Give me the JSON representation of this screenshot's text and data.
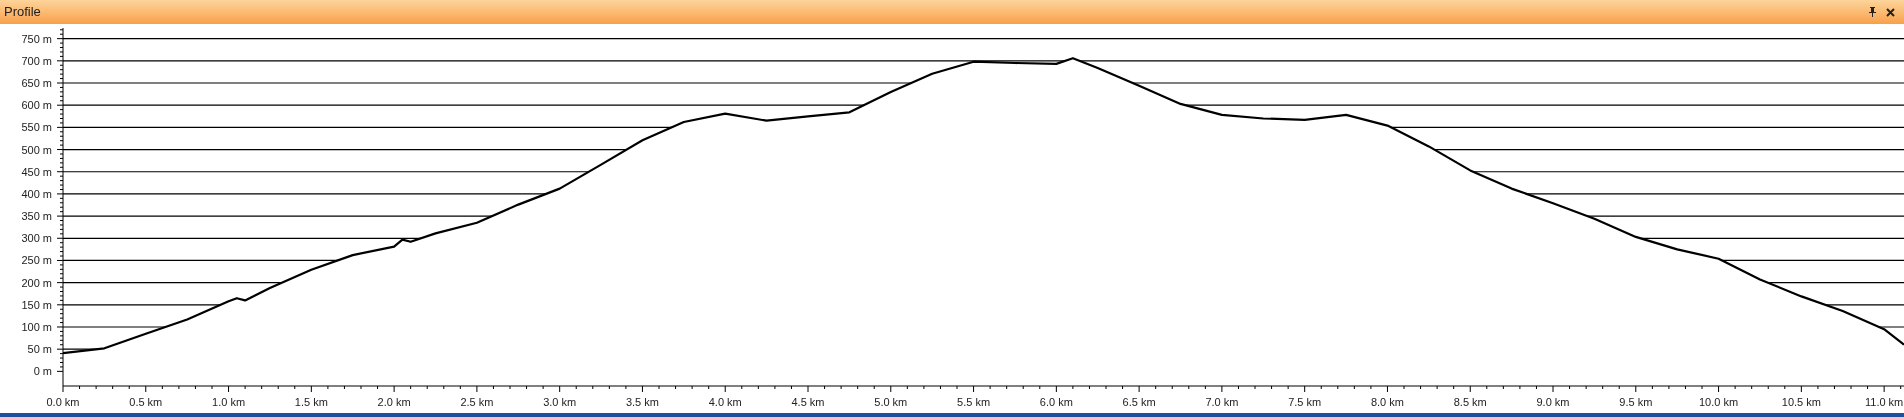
{
  "panel": {
    "title": "Profile"
  },
  "chart_data": {
    "type": "line",
    "grid": true,
    "xlim": [
      0,
      11.12
    ],
    "ylim": [
      -33,
      774
    ],
    "x": [
      0,
      0.25,
      0.5,
      0.75,
      1.0,
      1.05,
      1.1,
      1.25,
      1.5,
      1.75,
      2.0,
      2.05,
      2.1,
      2.25,
      2.5,
      2.75,
      3.0,
      3.25,
      3.5,
      3.75,
      4.0,
      4.25,
      4.5,
      4.75,
      5.0,
      5.25,
      5.5,
      5.75,
      6.0,
      6.1,
      6.25,
      6.5,
      6.75,
      7.0,
      7.25,
      7.5,
      7.75,
      8.0,
      8.25,
      8.5,
      8.75,
      9.0,
      9.25,
      9.5,
      9.75,
      10.0,
      10.25,
      10.5,
      10.75,
      11.0,
      11.12
    ],
    "values": [
      41,
      52,
      85,
      117,
      158,
      165,
      160,
      188,
      229,
      262,
      281,
      297,
      292,
      311,
      335,
      376,
      412,
      466,
      521,
      562,
      581,
      565,
      575,
      584,
      630,
      671,
      698,
      695,
      693,
      706,
      684,
      644,
      603,
      578,
      570,
      567,
      578,
      554,
      507,
      453,
      412,
      379,
      344,
      303,
      275,
      254,
      207,
      169,
      136,
      95,
      60
    ],
    "yticks": [
      {
        "value": 0,
        "label": "0 m"
      },
      {
        "value": 50,
        "label": "50 m"
      },
      {
        "value": 100,
        "label": "100 m"
      },
      {
        "value": 150,
        "label": "150 m"
      },
      {
        "value": 200,
        "label": "200 m"
      },
      {
        "value": 250,
        "label": "250 m"
      },
      {
        "value": 300,
        "label": "300 m"
      },
      {
        "value": 350,
        "label": "350 m"
      },
      {
        "value": 400,
        "label": "400 m"
      },
      {
        "value": 450,
        "label": "450 m"
      },
      {
        "value": 500,
        "label": "500 m"
      },
      {
        "value": 550,
        "label": "550 m"
      },
      {
        "value": 600,
        "label": "600 m"
      },
      {
        "value": 650,
        "label": "650 m"
      },
      {
        "value": 700,
        "label": "700 m"
      },
      {
        "value": 750,
        "label": "750 m"
      }
    ],
    "xticks": [
      {
        "value": 0,
        "label": "0.0 km"
      },
      {
        "value": 0.5,
        "label": "0.5 km"
      },
      {
        "value": 1,
        "label": "1.0 km"
      },
      {
        "value": 1.5,
        "label": "1.5 km"
      },
      {
        "value": 2,
        "label": "2.0 km"
      },
      {
        "value": 2.5,
        "label": "2.5 km"
      },
      {
        "value": 3,
        "label": "3.0 km"
      },
      {
        "value": 3.5,
        "label": "3.5 km"
      },
      {
        "value": 4,
        "label": "4.0 km"
      },
      {
        "value": 4.5,
        "label": "4.5 km"
      },
      {
        "value": 5,
        "label": "5.0 km"
      },
      {
        "value": 5.5,
        "label": "5.5 km"
      },
      {
        "value": 6,
        "label": "6.0 km"
      },
      {
        "value": 6.5,
        "label": "6.5 km"
      },
      {
        "value": 7,
        "label": "7.0 km"
      },
      {
        "value": 7.5,
        "label": "7.5 km"
      },
      {
        "value": 8,
        "label": "8.0 km"
      },
      {
        "value": 8.5,
        "label": "8.5 km"
      },
      {
        "value": 9,
        "label": "9.0 km"
      },
      {
        "value": 9.5,
        "label": "9.5 km"
      },
      {
        "value": 10,
        "label": "10.0 km"
      },
      {
        "value": 10.5,
        "label": "10.5 km"
      },
      {
        "value": 11,
        "label": "11.0 km"
      }
    ]
  }
}
